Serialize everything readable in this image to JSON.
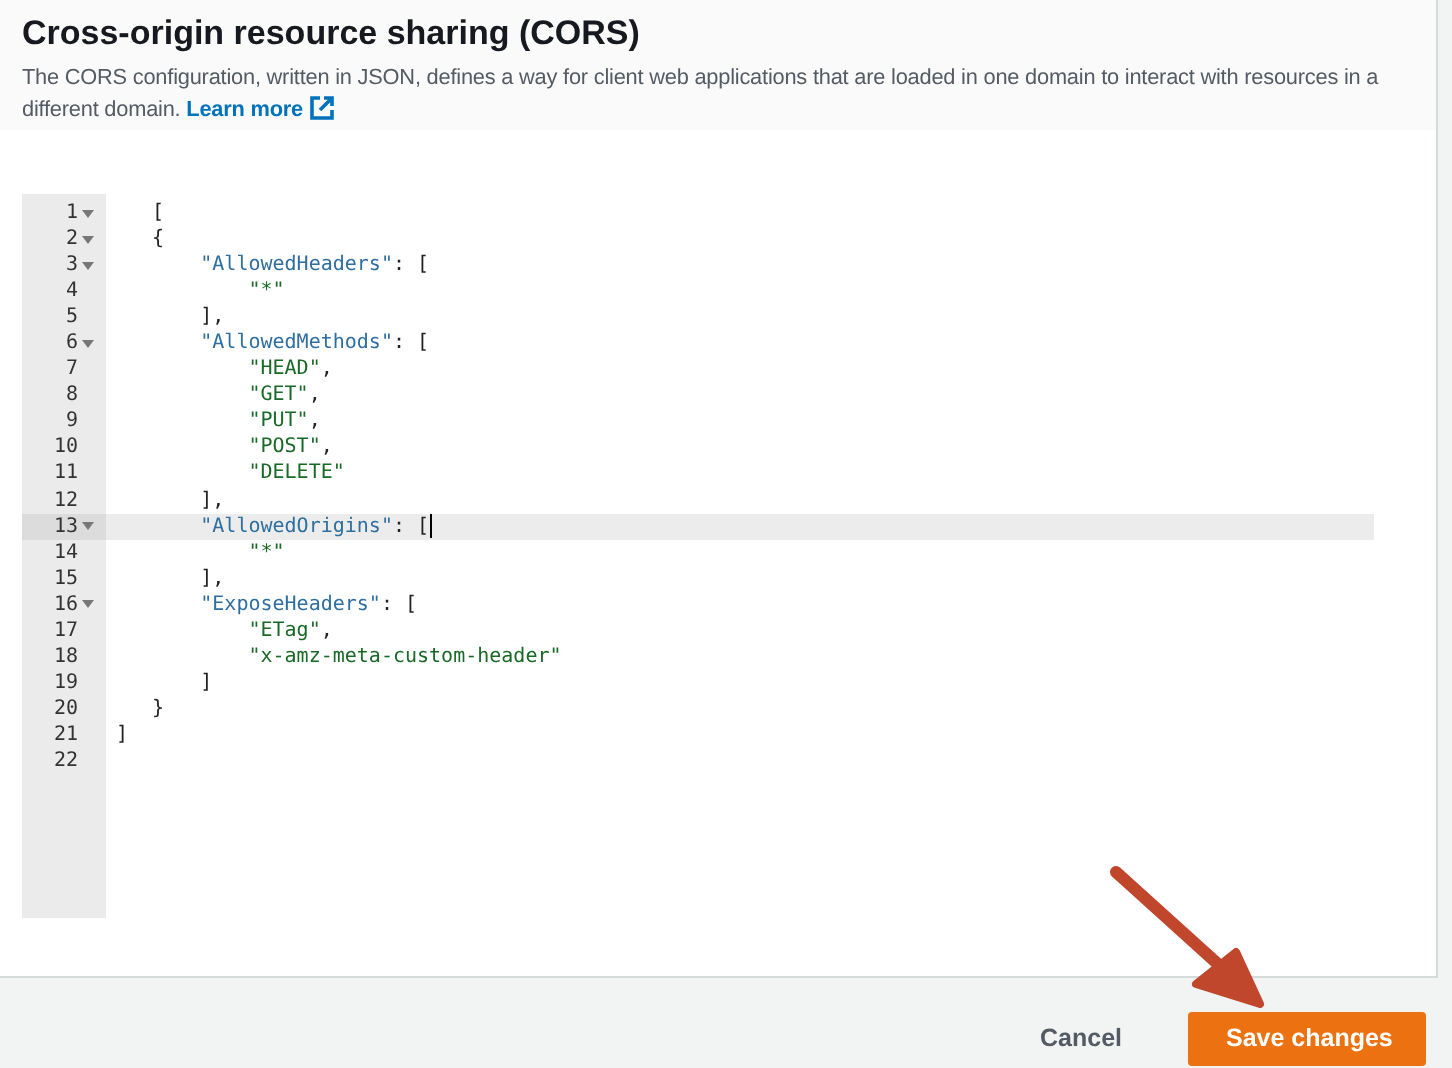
{
  "header": {
    "title": "Cross-origin resource sharing (CORS)",
    "description": "The CORS configuration, written in JSON, defines a way for client web applications that are loaded in one domain to interact with resources in a different domain.",
    "link": "Learn more"
  },
  "editor": {
    "lines": [
      {
        "number": "1",
        "foldable": true,
        "active": false,
        "tokens": [
          {
            "kind": "punct",
            "text": "   ["
          }
        ]
      },
      {
        "number": "2",
        "foldable": true,
        "active": false,
        "tokens": [
          {
            "kind": "punct",
            "text": "   {"
          }
        ]
      },
      {
        "number": "3",
        "foldable": true,
        "active": false,
        "tokens": [
          {
            "kind": "key",
            "text": "       \"AllowedHeaders\""
          },
          {
            "kind": "punct",
            "text": ": ["
          }
        ]
      },
      {
        "number": "4",
        "foldable": false,
        "active": false,
        "tokens": [
          {
            "kind": "string",
            "text": "           \"*\""
          }
        ]
      },
      {
        "number": "5",
        "foldable": false,
        "active": false,
        "tokens": [
          {
            "kind": "punct",
            "text": "       ],"
          }
        ]
      },
      {
        "number": "6",
        "foldable": true,
        "active": false,
        "tokens": [
          {
            "kind": "key",
            "text": "       \"AllowedMethods\""
          },
          {
            "kind": "punct",
            "text": ": ["
          }
        ]
      },
      {
        "number": "7",
        "foldable": false,
        "active": false,
        "tokens": [
          {
            "kind": "string",
            "text": "           \"HEAD\""
          },
          {
            "kind": "punct",
            "text": ","
          }
        ]
      },
      {
        "number": "8",
        "foldable": false,
        "active": false,
        "tokens": [
          {
            "kind": "string",
            "text": "           \"GET\""
          },
          {
            "kind": "punct",
            "text": ","
          }
        ]
      },
      {
        "number": "9",
        "foldable": false,
        "active": false,
        "tokens": [
          {
            "kind": "string",
            "text": "           \"PUT\""
          },
          {
            "kind": "punct",
            "text": ","
          }
        ]
      },
      {
        "number": "10",
        "foldable": false,
        "active": false,
        "tokens": [
          {
            "kind": "string",
            "text": "           \"POST\""
          },
          {
            "kind": "punct",
            "text": ","
          }
        ]
      },
      {
        "number": "11",
        "foldable": false,
        "active": false,
        "tokens": [
          {
            "kind": "string",
            "text": "           \"DELETE\""
          }
        ]
      },
      {
        "number": "12",
        "foldable": false,
        "active": false,
        "tokens": [
          {
            "kind": "punct",
            "text": "       ],"
          }
        ]
      },
      {
        "number": "13",
        "foldable": true,
        "active": true,
        "tokens": [
          {
            "kind": "key",
            "text": "       \"AllowedOrigins\""
          },
          {
            "kind": "punct",
            "text": ": ["
          }
        ]
      },
      {
        "number": "14",
        "foldable": false,
        "active": false,
        "tokens": [
          {
            "kind": "string",
            "text": "           \"*\""
          }
        ]
      },
      {
        "number": "15",
        "foldable": false,
        "active": false,
        "tokens": [
          {
            "kind": "punct",
            "text": "       ],"
          }
        ]
      },
      {
        "number": "16",
        "foldable": true,
        "active": false,
        "tokens": [
          {
            "kind": "key",
            "text": "       \"ExposeHeaders\""
          },
          {
            "kind": "punct",
            "text": ": ["
          }
        ]
      },
      {
        "number": "17",
        "foldable": false,
        "active": false,
        "tokens": [
          {
            "kind": "string",
            "text": "           \"ETag\""
          },
          {
            "kind": "punct",
            "text": ","
          }
        ]
      },
      {
        "number": "18",
        "foldable": false,
        "active": false,
        "tokens": [
          {
            "kind": "string",
            "text": "           \"x-amz-meta-custom-header\""
          }
        ]
      },
      {
        "number": "19",
        "foldable": false,
        "active": false,
        "tokens": [
          {
            "kind": "punct",
            "text": "       ]"
          }
        ]
      },
      {
        "number": "20",
        "foldable": false,
        "active": false,
        "tokens": [
          {
            "kind": "punct",
            "text": "   }"
          }
        ]
      },
      {
        "number": "21",
        "foldable": false,
        "active": false,
        "tokens": [
          {
            "kind": "punct",
            "text": "]"
          }
        ]
      },
      {
        "number": "22",
        "foldable": false,
        "active": false
      }
    ]
  },
  "footer": {
    "buttons": [
      {
        "label": "Cancel",
        "kind": "link"
      },
      {
        "label": "Save changes",
        "kind": "primary"
      }
    ]
  }
}
